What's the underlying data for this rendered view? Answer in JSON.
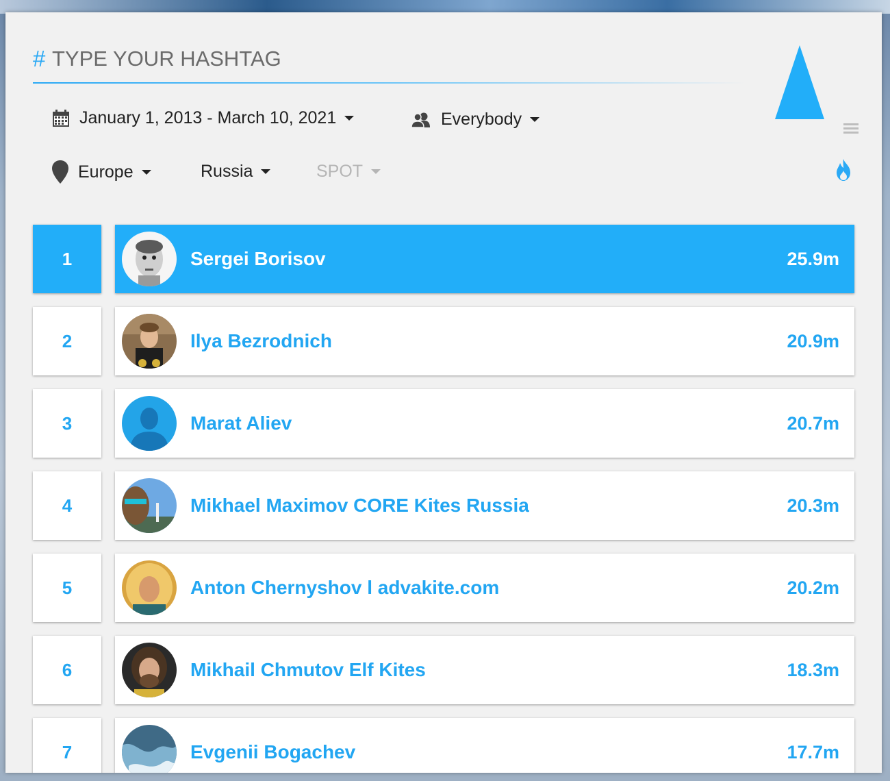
{
  "search": {
    "hash_symbol": "#",
    "placeholder": "TYPE YOUR HASHTAG"
  },
  "filters": {
    "date_range": "January 1, 2013 - March 10, 2021",
    "audience": "Everybody",
    "region": "Europe",
    "country": "Russia",
    "spot": "SPOT"
  },
  "icons": {
    "calendar": "calendar-icon",
    "users": "users-icon",
    "location": "map-pin-icon",
    "menu": "hamburger-menu-icon",
    "fire": "fire-icon",
    "triangle": "triangle-logo-icon"
  },
  "colors": {
    "accent": "#22aef9",
    "text_blue": "#22a6f2",
    "panel": "#f1f1f1"
  },
  "leaderboard": [
    {
      "rank": "1",
      "name": "Sergei Borisov",
      "value": "25.9m"
    },
    {
      "rank": "2",
      "name": "Ilya Bezrodnich",
      "value": "20.9m"
    },
    {
      "rank": "3",
      "name": "Marat Aliev",
      "value": "20.7m"
    },
    {
      "rank": "4",
      "name": "Mikhael Maximov CORE Kites Russia",
      "value": "20.3m"
    },
    {
      "rank": "5",
      "name": "Anton Chernyshov l advakite.com",
      "value": "20.2m"
    },
    {
      "rank": "6",
      "name": "Mikhail Chmutov Elf Kites",
      "value": "18.3m"
    },
    {
      "rank": "7",
      "name": "Evgenii Bogachev",
      "value": "17.7m"
    }
  ]
}
